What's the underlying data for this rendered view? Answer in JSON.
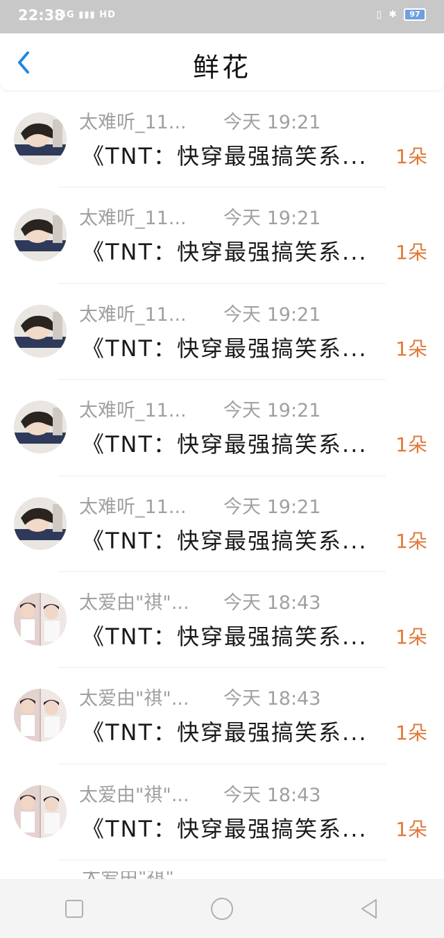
{
  "status_bar": {
    "time": "22:38",
    "network": "4G",
    "signal_icons": "4G ▮▮▮ HD",
    "battery": "97"
  },
  "header": {
    "title": "鲜花"
  },
  "colors": {
    "accent_blue": "#1e88e5",
    "count_orange": "#e07a3a",
    "meta_gray": "#a0a0a0"
  },
  "list": [
    {
      "name": "太难听_11...",
      "time": "今天 19:21",
      "message": "《TNT：快穿最强搞笑系...",
      "count": "1朵",
      "avatar": "girl-sleeping-avatar"
    },
    {
      "name": "太难听_11...",
      "time": "今天 19:21",
      "message": "《TNT：快穿最强搞笑系...",
      "count": "1朵",
      "avatar": "girl-sleeping-avatar"
    },
    {
      "name": "太难听_11...",
      "time": "今天 19:21",
      "message": "《TNT：快穿最强搞笑系...",
      "count": "1朵",
      "avatar": "girl-sleeping-avatar"
    },
    {
      "name": "太难听_11...",
      "time": "今天 19:21",
      "message": "《TNT：快穿最强搞笑系...",
      "count": "1朵",
      "avatar": "girl-sleeping-avatar"
    },
    {
      "name": "太难听_11...",
      "time": "今天 19:21",
      "message": "《TNT：快穿最强搞笑系...",
      "count": "1朵",
      "avatar": "girl-sleeping-avatar"
    },
    {
      "name": "太爱由\"祺\"...",
      "time": "今天 18:43",
      "message": "《TNT：快穿最强搞笑系...",
      "count": "1朵",
      "avatar": "two-boys-avatar"
    },
    {
      "name": "太爱由\"祺\"...",
      "time": "今天 18:43",
      "message": "《TNT：快穿最强搞笑系...",
      "count": "1朵",
      "avatar": "two-boys-avatar"
    },
    {
      "name": "太爱由\"祺\"...",
      "time": "今天 18:43",
      "message": "《TNT：快穿最强搞笑系...",
      "count": "1朵",
      "avatar": "two-boys-avatar"
    }
  ],
  "nav": {
    "recent_icon": "square-icon",
    "home_icon": "circle-icon",
    "back_icon": "triangle-back-icon"
  }
}
